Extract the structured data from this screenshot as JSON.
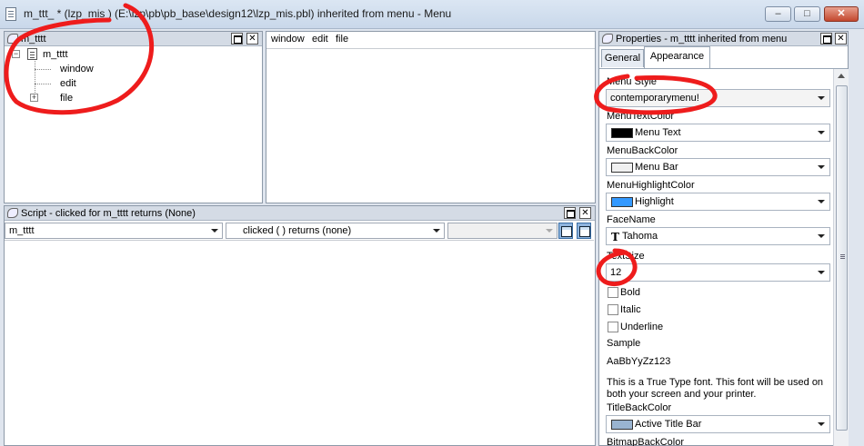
{
  "window": {
    "title": "m_ttt_ * (lzp_mis ) (E:\\lzp\\pb\\pb_base\\design12\\lzp_mis.pbl) inherited from menu - Menu",
    "controls": {
      "minimize": "–",
      "maximize": "□",
      "close": "✕"
    }
  },
  "tree_pane": {
    "title": "m_tttt",
    "items": [
      "m_tttt",
      "window",
      "edit",
      "file"
    ],
    "expand_symbol_root": "−",
    "expand_symbol_file": "+"
  },
  "menubar_pane": {
    "items": [
      "window",
      "edit",
      "file"
    ]
  },
  "script_pane": {
    "title": "Script - clicked for m_tttt returns (None)",
    "object_select": "m_tttt",
    "event_select": "clicked ( ) returns (none)",
    "ancestor_select": ""
  },
  "properties": {
    "title": "Properties - m_tttt  inherited  from  menu",
    "tabs": [
      "General",
      "Appearance"
    ],
    "active_tab": "Appearance",
    "fields": {
      "menu_style_label": "Menu Style",
      "menu_style_value": "contemporarymenu!",
      "menu_text_color_label": "MenuTextColor",
      "menu_text_color_value": "Menu Text",
      "menu_back_color_label": "MenuBackColor",
      "menu_back_color_value": "Menu Bar",
      "menu_highlight_color_label": "MenuHighlightColor",
      "menu_highlight_color_value": "Highlight",
      "face_name_label": "FaceName",
      "face_name_value": "Tahoma",
      "text_size_label": "TextSize",
      "text_size_value": "12",
      "bold_label": "Bold",
      "italic_label": "Italic",
      "underline_label": "Underline",
      "sample_label": "Sample",
      "sample_text": "AaBbYyZz123",
      "font_note_line1": "This is a True Type font. This font will be used on",
      "font_note_line2": "both your screen and your printer.",
      "title_back_color_label": "TitleBackColor",
      "title_back_color_value": "Active Title Bar",
      "bitmap_back_color_label": "BitmapBackColor"
    },
    "colors": {
      "menu_text": "#000000",
      "menu_bar": "#f0f0f0",
      "highlight": "#3399ff",
      "active_title_bar": "#99b4d1"
    }
  }
}
